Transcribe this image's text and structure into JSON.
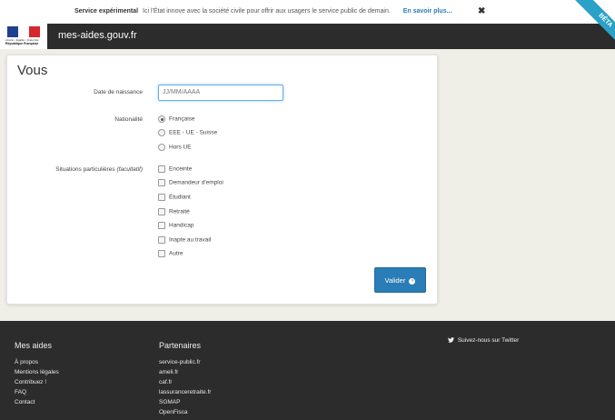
{
  "notice": {
    "title": "Service expérimental",
    "text": "Ici l'État innove avec la société civile pour offrir aux usagers le service public de demain.",
    "link": "En savoir plus...",
    "close": "✖"
  },
  "header": {
    "logo_line1": "Liberté • Égalité • Fraternité",
    "logo_line2": "République Française",
    "site": "mes-aides.gouv.fr",
    "beta": "BÊTA"
  },
  "form": {
    "title": "Vous",
    "birth_label": "Date de naissance",
    "birth_placeholder": "JJ/MM/AAAA",
    "nationality_label": "Nationalité",
    "nationalities": [
      {
        "label": "Française",
        "selected": true
      },
      {
        "label": "EEE - UE - Suisse",
        "selected": false
      },
      {
        "label": "Hors UE",
        "selected": false
      }
    ],
    "situations_label": "Situations particulières",
    "situations_optional": "(facultatif)",
    "situations": [
      "Enceinte",
      "Demandeur d'emploi",
      "Étudiant",
      "Retraité",
      "Handicap",
      "Inapte au travail",
      "Autre"
    ],
    "submit": "Valider"
  },
  "footer": {
    "col1_title": "Mes aides",
    "col1_links": [
      "À propos",
      "Mentions légales",
      "Contribuez !",
      "FAQ",
      "Contact"
    ],
    "col2_title": "Partenaires",
    "col2_links": [
      "service-public.fr",
      "ameli.fr",
      "caf.fr",
      "lassuranceretraite.fr",
      "SGMAP",
      "OpenFisca"
    ],
    "twitter": "Suivez-nous sur Twitter"
  },
  "colors": {
    "accent": "#2a7db6",
    "header_bg": "#2c2c2c",
    "page_bg": "#efeee7",
    "beta": "#2aa1c7"
  },
  "icons": {
    "close": "close-icon",
    "submit_arrow": "arrow-right-circle-icon",
    "twitter": "twitter-icon"
  }
}
